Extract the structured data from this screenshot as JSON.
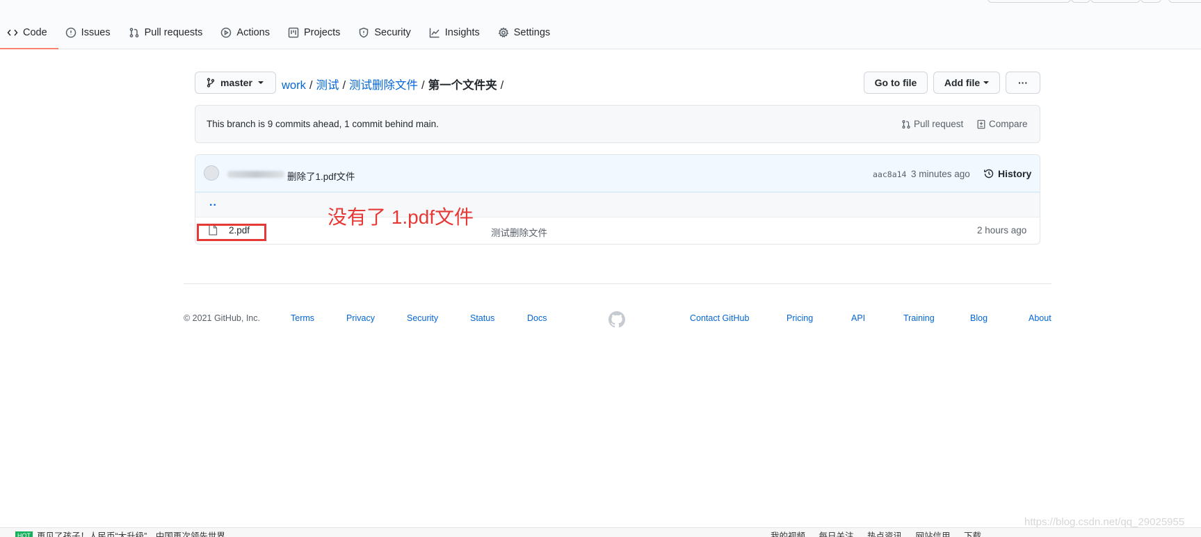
{
  "repo_nav": {
    "tabs": [
      {
        "label": "Code",
        "icon": "code-icon",
        "selected": true
      },
      {
        "label": "Issues",
        "icon": "issue-icon",
        "selected": false
      },
      {
        "label": "Pull requests",
        "icon": "pull-request-icon",
        "selected": false
      },
      {
        "label": "Actions",
        "icon": "play-icon",
        "selected": false
      },
      {
        "label": "Projects",
        "icon": "project-icon",
        "selected": false
      },
      {
        "label": "Security",
        "icon": "shield-icon",
        "selected": false
      },
      {
        "label": "Insights",
        "icon": "graph-icon",
        "selected": false
      },
      {
        "label": "Settings",
        "icon": "gear-icon",
        "selected": false
      }
    ],
    "accent_color": "#f9826c"
  },
  "file_nav": {
    "branch": "master",
    "breadcrumb": {
      "links": [
        "work",
        "测试",
        "测试删除文件"
      ],
      "current": "第一个文件夹",
      "separator": "/"
    },
    "go_to_file": "Go to file",
    "add_file": "Add file",
    "more": "···"
  },
  "branch_info": {
    "text": "This branch is 9 commits ahead, 1 commit behind main.",
    "pull_request": "Pull request",
    "compare": "Compare"
  },
  "latest_commit": {
    "message": "删除了1.pdf文件",
    "sha": "aac8a14",
    "time": "3 minutes ago",
    "history": "History"
  },
  "files": {
    "parent_dir": "..",
    "items": [
      {
        "name": "2.pdf",
        "commit": "测试删除文件",
        "age": "2 hours ago"
      }
    ]
  },
  "annotation": {
    "text": "没有了 1.pdf文件",
    "color": "#e53935"
  },
  "footer": {
    "copyright": "© 2021 GitHub, Inc.",
    "left_links": [
      "Terms",
      "Privacy",
      "Security",
      "Status",
      "Docs"
    ],
    "right_links": [
      "Contact GitHub",
      "Pricing",
      "API",
      "Training",
      "Blog",
      "About"
    ]
  },
  "status_bar": {
    "news_badge": "HOT",
    "news": "再见了孩子！人民币“大升级”，中国再次领先世界",
    "items": [
      "我的视频",
      "每日关注",
      "热点资讯",
      "网站信用",
      "下载"
    ]
  },
  "watermark": "https://blog.csdn.net/qq_29025955"
}
